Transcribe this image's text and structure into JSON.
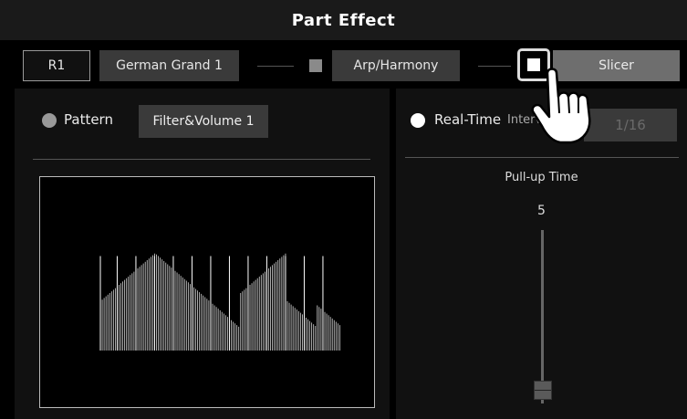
{
  "title": "Part Effect",
  "route": {
    "part_label": "R1",
    "voice_label": "German Grand 1",
    "arp_label": "Arp/Harmony",
    "slicer_label": "Slicer"
  },
  "pattern": {
    "label": "Pattern",
    "value": "Filter&Volume 1"
  },
  "realtime": {
    "label": "Real-Time",
    "interval_label": "Interv",
    "interval_value": "1/16"
  },
  "pullup": {
    "label": "Pull-up Time",
    "value": "5"
  },
  "chart_data": {
    "type": "bar",
    "values": [
      60,
      62,
      64,
      66,
      68,
      70,
      72,
      74,
      76,
      78,
      80,
      82,
      84,
      86,
      88,
      90,
      92,
      94,
      96,
      98,
      100,
      102,
      104,
      106,
      108,
      110,
      112,
      114,
      116,
      118,
      117,
      115,
      113,
      111,
      109,
      107,
      105,
      103,
      101,
      99,
      97,
      95,
      93,
      91,
      89,
      87,
      85,
      83,
      81,
      79,
      77,
      75,
      73,
      71,
      69,
      67,
      65,
      63,
      61,
      59,
      57,
      55,
      53,
      51,
      49,
      47,
      45,
      43,
      41,
      39,
      37,
      35,
      33,
      31,
      29,
      70,
      72,
      74,
      76,
      78,
      80,
      82,
      84,
      86,
      88,
      90,
      92,
      94,
      96,
      98,
      100,
      102,
      104,
      106,
      108,
      110,
      112,
      114,
      116,
      118,
      60,
      58,
      56,
      54,
      52,
      50,
      48,
      46,
      44,
      42,
      40,
      38,
      36,
      34,
      32,
      30,
      55,
      53,
      51,
      49,
      47,
      45,
      43,
      41,
      39,
      37,
      35,
      33,
      31
    ],
    "tall_values": [
      115,
      0,
      0,
      0,
      0,
      0,
      0,
      0,
      0,
      115,
      0,
      0,
      0,
      0,
      0,
      0,
      0,
      0,
      0,
      115,
      0,
      0,
      0,
      0,
      0,
      0,
      0,
      0,
      0,
      115,
      0,
      0,
      0,
      0,
      0,
      0,
      0,
      0,
      0,
      115,
      0,
      0,
      0,
      0,
      0,
      0,
      0,
      0,
      0,
      115,
      0,
      0,
      0,
      0,
      0,
      0,
      0,
      0,
      0,
      115,
      0,
      0,
      0,
      0,
      0,
      0,
      0,
      0,
      0,
      115,
      0,
      0,
      0,
      0,
      0,
      0,
      0,
      0,
      0,
      115,
      0,
      0,
      0,
      0,
      0,
      0,
      0,
      0,
      0,
      115,
      0,
      0,
      0,
      0,
      0,
      0,
      0,
      0,
      0,
      115,
      0,
      0,
      0,
      0,
      0,
      0,
      0,
      0,
      0,
      115,
      0,
      0,
      0,
      0,
      0,
      0,
      0,
      0,
      0,
      115,
      0,
      0,
      0,
      0,
      0,
      0,
      0,
      0,
      0,
      115
    ],
    "ylim": [
      0,
      120
    ]
  }
}
